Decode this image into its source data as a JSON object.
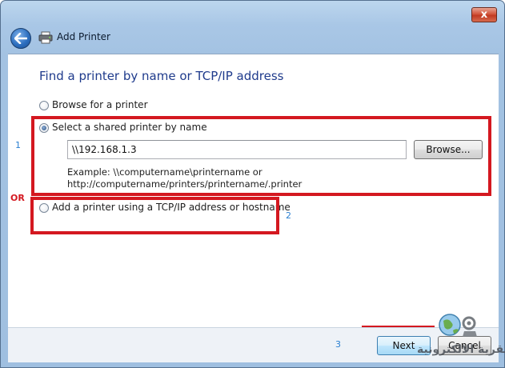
{
  "window": {
    "title": "Add Printer",
    "close_glyph": "x"
  },
  "page": {
    "heading": "Find a printer by name or TCP/IP address"
  },
  "options": {
    "browse": {
      "label": "Browse for a printer",
      "selected": false
    },
    "shared": {
      "label": "Select a shared printer by name",
      "selected": true
    },
    "tcpip": {
      "label": "Add a printer using a TCP/IP address or hostname",
      "selected": false
    }
  },
  "shared_name": {
    "value": "\\\\192.168.1.3",
    "browse_label": "Browse...",
    "example_line1": "Example: \\\\computername\\printername or",
    "example_line2": "http://computername/printers/printername/.printer"
  },
  "annotations": {
    "marker1": "1",
    "marker2": "2",
    "marker3": "3",
    "or_label": "OR",
    "highlight_color": "#d41820",
    "marker_color": "#2a7fd1"
  },
  "footer": {
    "next_label": "Next",
    "cancel_label": "Cancel"
  },
  "watermark": {
    "text": "القرية الالكترونية",
    "logo_icon": "globe-gear-logo"
  },
  "icons": {
    "back": "back-arrow-icon",
    "printer": "printer-icon",
    "close": "close-icon"
  }
}
